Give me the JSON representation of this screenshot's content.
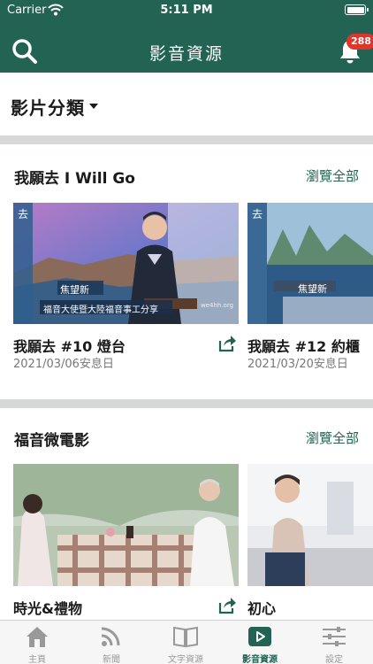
{
  "status_bar": {
    "carrier": "Carrier",
    "time": "5:11 PM"
  },
  "nav": {
    "title": "影音資源",
    "notification_count": "288"
  },
  "category": {
    "label": "影片分類"
  },
  "sections": [
    {
      "title": "我願去 I Will Go",
      "view_all": "瀏覽全部",
      "cards": [
        {
          "title": "我願去 #10 燈台",
          "date": "2021/03/06安息日",
          "name_caption": "焦望新",
          "subtitle": "福音大使暨大陸福音事工分享",
          "watermark": "we4hh.org",
          "side_text": "去"
        },
        {
          "title": "我願去 #12 約櫃",
          "date": "2021/03/20安息日",
          "name_caption": "焦望新",
          "side_text": "去"
        }
      ]
    },
    {
      "title": "福音微電影",
      "view_all": "瀏覽全部",
      "cards": [
        {
          "title": "時光&禮物"
        },
        {
          "title": "初心"
        }
      ]
    }
  ],
  "tabs": [
    {
      "label": "主頁",
      "icon": "home-icon"
    },
    {
      "label": "新聞",
      "icon": "rss-icon"
    },
    {
      "label": "文字資源",
      "icon": "book-icon"
    },
    {
      "label": "影音資源",
      "icon": "play-icon",
      "active": true
    },
    {
      "label": "設定",
      "icon": "sliders-icon"
    }
  ],
  "colors": {
    "brand": "#236353",
    "badge": "#e0352b",
    "divider": "#d7d9d8"
  }
}
